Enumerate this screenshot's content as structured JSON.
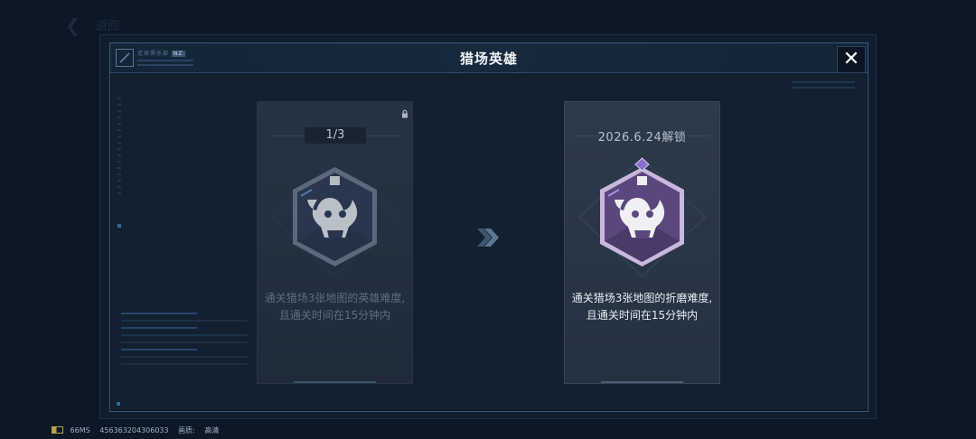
{
  "background": {
    "back_label": "返回"
  },
  "modal": {
    "title": "猎场英雄",
    "header_code": "足球俱乐部",
    "header_code_badge": "NZ"
  },
  "cards": [
    {
      "state": "locked",
      "progress": "1/3",
      "description_line1": "通关猎场3张地图的英雄难度,",
      "description_line2": "且通关时间在15分钟内",
      "badge_color": "#2e3c56"
    },
    {
      "state": "upcoming",
      "unlock_date": "2026.6.24解锁",
      "description_line1": "通关猎场3张地图的折磨难度,",
      "description_line2": "且通关时间在15分钟内",
      "badge_color": "#5b477e"
    }
  ],
  "footer": {
    "ping": "66MS",
    "uid": "456363204306033",
    "quality_label": "画质:",
    "quality_value": "高清"
  },
  "colors": {
    "accent": "#3a5a80",
    "background": "#0c1826"
  },
  "icons": [
    "back-arrow-icon",
    "edit-icon",
    "close-icon",
    "lock-icon",
    "demon-skull-icon",
    "double-chevron-right-icon",
    "battery-icon"
  ]
}
